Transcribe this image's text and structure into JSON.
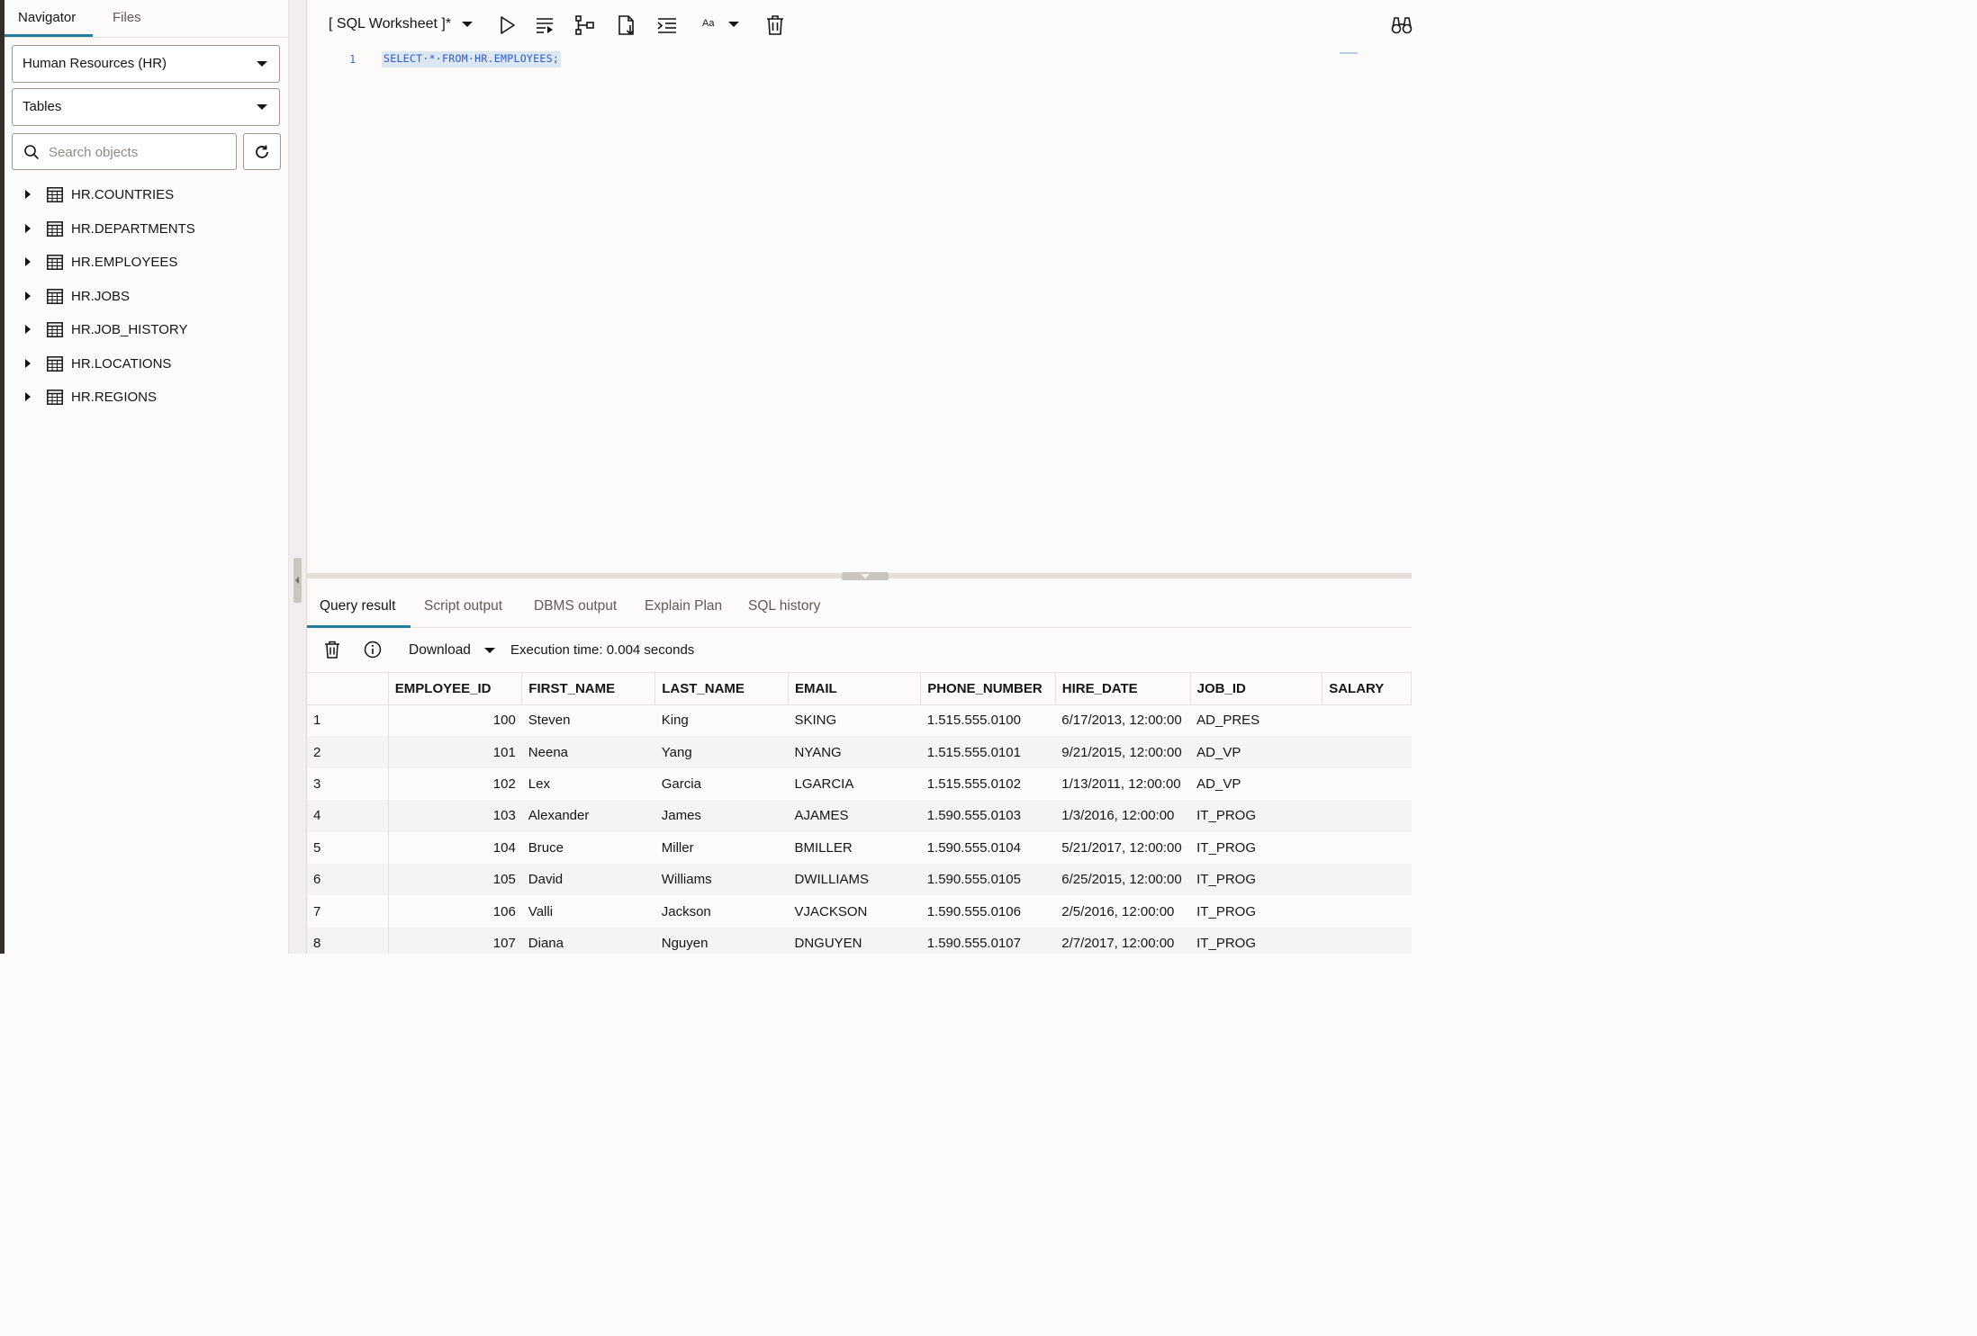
{
  "navigator": {
    "tabs": [
      "Navigator",
      "Files"
    ],
    "schema_select": "Human Resources (HR)",
    "object_type_select": "Tables",
    "search_placeholder": "Search objects",
    "tables": [
      "HR.COUNTRIES",
      "HR.DEPARTMENTS",
      "HR.EMPLOYEES",
      "HR.JOBS",
      "HR.JOB_HISTORY",
      "HR.LOCATIONS",
      "HR.REGIONS"
    ]
  },
  "toolbar": {
    "worksheet_title": "[ SQL Worksheet ]*",
    "font_label": "Aa",
    "icons": [
      "run-statement-icon",
      "run-script-icon",
      "explain-plan-icon",
      "autotrace-icon",
      "format-icon",
      "font-size-icon",
      "clear-icon",
      "binoculars-icon"
    ]
  },
  "editor": {
    "line_number": "1",
    "code": "SELECT·*·FROM·HR.EMPLOYEES;"
  },
  "results": {
    "tabs": [
      "Query result",
      "Script output",
      "DBMS output",
      "Explain Plan",
      "SQL history"
    ],
    "download_label": "Download",
    "execution_time": "Execution time: 0.004 seconds",
    "columns": [
      "",
      "EMPLOYEE_ID",
      "FIRST_NAME",
      "LAST_NAME",
      "EMAIL",
      "PHONE_NUMBER",
      "HIRE_DATE",
      "JOB_ID",
      "SALARY"
    ],
    "rows": [
      [
        "1",
        "100",
        "Steven",
        "King",
        "SKING",
        "1.515.555.0100",
        "6/17/2013, 12:00:00",
        "AD_PRES",
        ""
      ],
      [
        "2",
        "101",
        "Neena",
        "Yang",
        "NYANG",
        "1.515.555.0101",
        "9/21/2015, 12:00:00",
        "AD_VP",
        ""
      ],
      [
        "3",
        "102",
        "Lex",
        "Garcia",
        "LGARCIA",
        "1.515.555.0102",
        "1/13/2011, 12:00:00",
        "AD_VP",
        ""
      ],
      [
        "4",
        "103",
        "Alexander",
        "James",
        "AJAMES",
        "1.590.555.0103",
        "1/3/2016, 12:00:00",
        "IT_PROG",
        ""
      ],
      [
        "5",
        "104",
        "Bruce",
        "Miller",
        "BMILLER",
        "1.590.555.0104",
        "5/21/2017, 12:00:00",
        "IT_PROG",
        ""
      ],
      [
        "6",
        "105",
        "David",
        "Williams",
        "DWILLIAMS",
        "1.590.555.0105",
        "6/25/2015, 12:00:00",
        "IT_PROG",
        ""
      ],
      [
        "7",
        "106",
        "Valli",
        "Jackson",
        "VJACKSON",
        "1.590.555.0106",
        "2/5/2016, 12:00:00",
        "IT_PROG",
        ""
      ],
      [
        "8",
        "107",
        "Diana",
        "Nguyen",
        "DNGUYEN",
        "1.590.555.0107",
        "2/7/2017, 12:00:00",
        "IT_PROG",
        ""
      ]
    ]
  },
  "colors": {
    "accent": "#227e9e",
    "code_text": "#2b58d6",
    "code_highlight": "#dde7f2"
  }
}
